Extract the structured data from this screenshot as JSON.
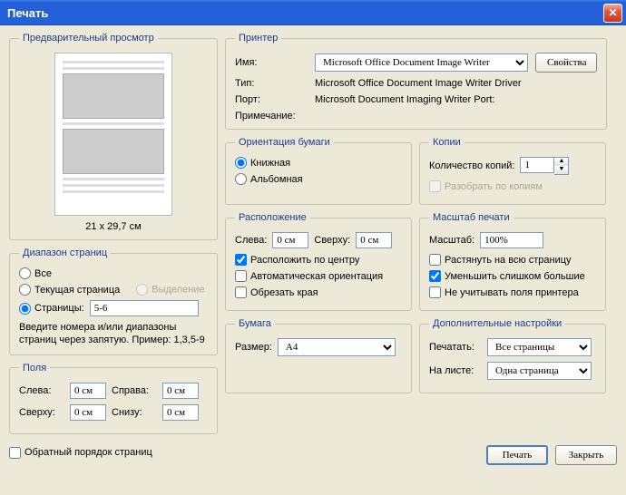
{
  "title": "Печать",
  "preview": {
    "legend": "Предварительный просмотр",
    "dimensions": "21 x 29,7 см"
  },
  "printer": {
    "legend": "Принтер",
    "name_label": "Имя:",
    "name_value": "Microsoft Office Document Image Writer",
    "properties_btn": "Свойства",
    "type_label": "Тип:",
    "type_value": "Microsoft Office Document Image Writer Driver",
    "port_label": "Порт:",
    "port_value": "Microsoft Document Imaging Writer Port:",
    "note_label": "Примечание:",
    "note_value": ""
  },
  "range": {
    "legend": "Диапазон страниц",
    "all": "Все",
    "current": "Текущая страница",
    "selection": "Выделение",
    "pages": "Страницы:",
    "pages_value": "5-6",
    "hint": "Введите номера и/или диапазоны страниц через запятую. Пример: 1,3,5-9"
  },
  "orientation": {
    "legend": "Ориентация бумаги",
    "portrait": "Книжная",
    "landscape": "Альбомная"
  },
  "copies": {
    "legend": "Копии",
    "count_label": "Количество копий:",
    "count_value": "1",
    "collate": "Разобрать по копиям"
  },
  "margins": {
    "legend": "Поля",
    "left": "Слева:",
    "right": "Справа:",
    "top": "Сверху:",
    "bottom": "Снизу:",
    "left_v": "0 см",
    "right_v": "0 см",
    "top_v": "0 см",
    "bottom_v": "0 см"
  },
  "layout": {
    "legend": "Расположение",
    "left": "Слева:",
    "left_v": "0 см",
    "top": "Сверху:",
    "top_v": "0 см",
    "center": "Расположить по центру",
    "auto_orient": "Автоматическая ориентация",
    "crop": "Обрезать края"
  },
  "scale": {
    "legend": "Масштаб печати",
    "label": "Масштаб:",
    "value": "100%",
    "stretch": "Растянуть на всю страницу",
    "shrink": "Уменьшить слишком большие",
    "ignore_margins": "Не учитывать поля принтера"
  },
  "paper": {
    "legend": "Бумага",
    "size_label": "Размер:",
    "size_value": "A4"
  },
  "extra": {
    "legend": "Дополнительные настройки",
    "print_label": "Печатать:",
    "print_value": "Все страницы",
    "sheet_label": "На листе:",
    "sheet_value": "Одна страница"
  },
  "footer": {
    "reverse": "Обратный порядок страниц",
    "print": "Печать",
    "close": "Закрыть"
  }
}
